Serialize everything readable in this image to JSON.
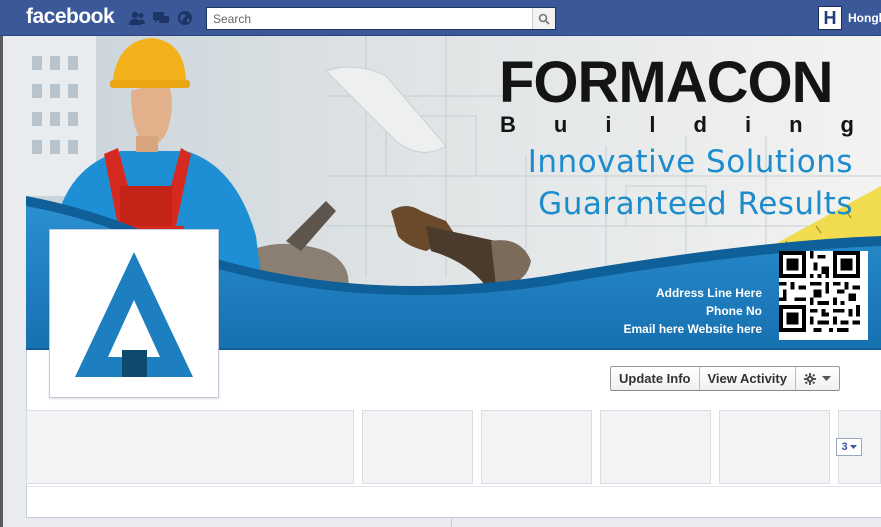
{
  "topbar": {
    "logo": "facebook",
    "search_placeholder": "Search",
    "user_initial": "H",
    "user_name": "Hongk"
  },
  "cover": {
    "brand_name": "FORMACON",
    "brand_sub_letters": [
      "B",
      "u",
      "i",
      "l",
      "d",
      "i",
      "n",
      "g"
    ],
    "tagline_1": "Innovative Solutions",
    "tagline_2": "Guaranteed Results",
    "address": "Address Line Here",
    "phone": "Phone No",
    "email_website": "Email here Website here"
  },
  "actions": {
    "update_info": "Update Info",
    "view_activity": "View Activity"
  },
  "tiles": {
    "more_count": "3"
  },
  "colors": {
    "facebook_blue": "#3b5998",
    "brand_blue": "#1d7fc0",
    "tagline_blue": "#1d8ccd"
  }
}
